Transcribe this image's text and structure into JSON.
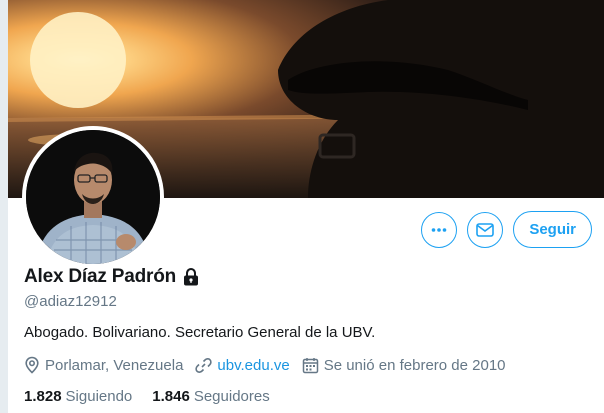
{
  "profile": {
    "name": "Alex Díaz Padrón",
    "handle": "@adiaz12912",
    "bio": "Abogado. Bolivariano. Secretario General de la UBV.",
    "location": "Porlamar, Venezuela",
    "website": "ubv.edu.ve",
    "joined": "Se unió en febrero de 2010",
    "protected_icon": "lock-icon"
  },
  "actions": {
    "more_icon": "more-icon",
    "message_icon": "envelope-icon",
    "follow_label": "Seguir"
  },
  "stats": {
    "following_count": "1.828",
    "following_label": "Siguiendo",
    "followers_count": "1.846",
    "followers_label": "Seguidores"
  },
  "colors": {
    "accent": "#1da1f2",
    "secondary_text": "#657786",
    "link": "#1b95e0"
  }
}
